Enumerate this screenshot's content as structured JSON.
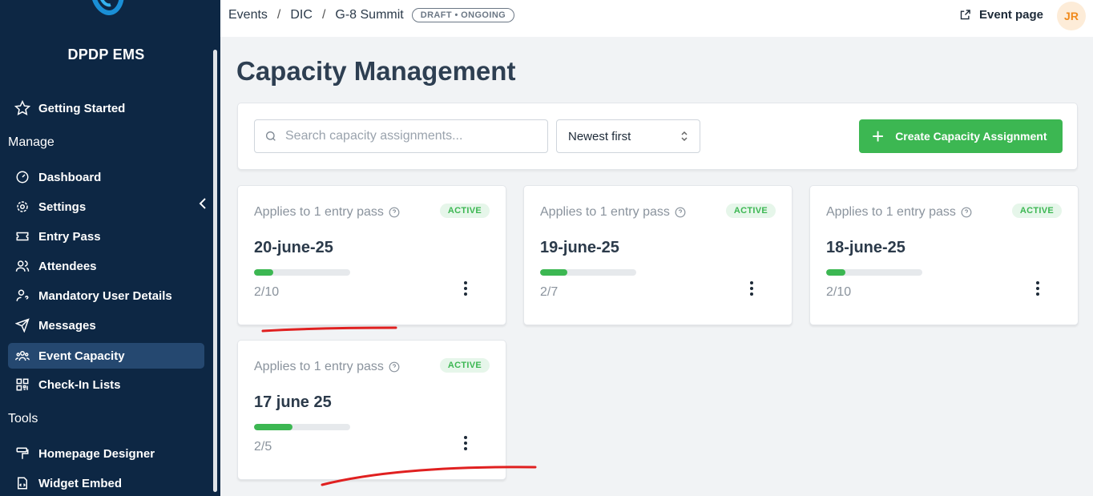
{
  "sidebar": {
    "brand": "DPDP EMS",
    "getting_started": "Getting Started",
    "section_manage": "Manage",
    "section_tools": "Tools",
    "items": [
      {
        "label": "Dashboard",
        "icon": "dashboard-icon"
      },
      {
        "label": "Settings",
        "icon": "gear-icon"
      },
      {
        "label": "Entry Pass",
        "icon": "ticket-icon"
      },
      {
        "label": "Attendees",
        "icon": "users-icon"
      },
      {
        "label": "Mandatory User Details",
        "icon": "user-question-icon"
      },
      {
        "label": "Messages",
        "icon": "send-icon"
      },
      {
        "label": "Event Capacity",
        "icon": "group-icon",
        "active": true
      },
      {
        "label": "Check-In Lists",
        "icon": "qr-icon"
      }
    ],
    "tools": [
      {
        "label": "Homepage Designer",
        "icon": "paint-roller-icon"
      },
      {
        "label": "Widget Embed",
        "icon": "embed-icon"
      }
    ]
  },
  "topbar": {
    "breadcrumbs": [
      "Events",
      "DIC",
      "G-8 Summit"
    ],
    "badge": "DRAFT • ONGOING",
    "event_page": "Event page",
    "avatar": "JR"
  },
  "page": {
    "title": "Capacity Management"
  },
  "toolbar": {
    "search_placeholder": "Search capacity assignments...",
    "sort_value": "Newest first",
    "create_label": "Create Capacity Assignment"
  },
  "cards": [
    {
      "applies": "Applies to 1 entry pass",
      "status": "ACTIVE",
      "name": "20-june-25",
      "count": "2/10",
      "used": 2,
      "capacity": 10
    },
    {
      "applies": "Applies to 1 entry pass",
      "status": "ACTIVE",
      "name": "19-june-25",
      "count": "2/7",
      "used": 2,
      "capacity": 7
    },
    {
      "applies": "Applies to 1 entry pass",
      "status": "ACTIVE",
      "name": "18-june-25",
      "count": "2/10",
      "used": 2,
      "capacity": 10
    },
    {
      "applies": "Applies to 1 entry pass",
      "status": "ACTIVE",
      "name": "17 june 25",
      "count": "2/5",
      "used": 2,
      "capacity": 5
    }
  ],
  "colors": {
    "sidebar_bg": "#0d2744",
    "active_item": "#254870",
    "accent_green": "#3cb752",
    "avatar_text": "#f08a1c",
    "annotation_red": "#e02020"
  }
}
